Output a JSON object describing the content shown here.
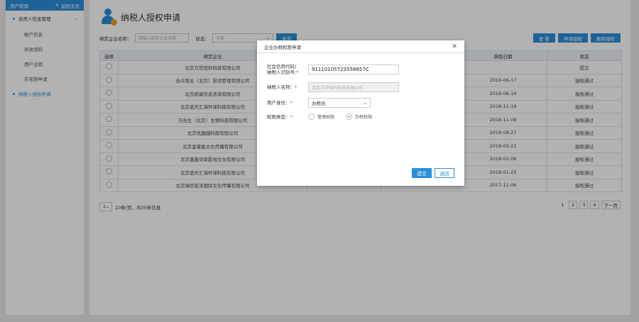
{
  "sidebar": {
    "header": "用户管理",
    "back_label": "返回主页",
    "groups": [
      {
        "label": "自然人信息管理",
        "items": [
          "帐户信息",
          "修改密码",
          "用户注销",
          "实名制申请"
        ]
      },
      {
        "label": "纳税人授权申请"
      }
    ]
  },
  "page": {
    "title": "纳税人授权申请",
    "filter_company_label": "绑定企业名称：",
    "filter_company_placeholder": "请输入绑定企业名称",
    "filter_status_label": "状态：",
    "filter_status_value": "全部",
    "query_button": "查询",
    "view_button": "查 看",
    "apply_button": "申请授权",
    "revoke_button": "解除授权"
  },
  "table": {
    "headers": [
      "选择",
      "绑定企业",
      "",
      "",
      "获取日期",
      "状态"
    ],
    "rows": [
      {
        "company": "北京方欣恒利科技有限公司",
        "date": "",
        "status": "提交"
      },
      {
        "company": "合众智业（北京）投资管理有限公司",
        "date": "2019-06-17",
        "status": "授权通过"
      },
      {
        "company": "北京拓睿信息咨询有限公司",
        "date": "2019-06-14",
        "status": "授权通过"
      },
      {
        "company": "北京蓝天汇海环保科技有限公司",
        "date": "2018-11-19",
        "status": "授权通过"
      },
      {
        "company": "万合生（北京）生物科技有限公司",
        "date": "2018-11-09",
        "status": "授权通过"
      },
      {
        "company": "北京优趣越科技有限公司",
        "date": "2018-08-27",
        "status": "授权通过"
      },
      {
        "company": "北京金睿盈文化传播有限公司",
        "date": "2018-03-21",
        "status": "授权通过"
      },
      {
        "company": "北京鑫鑫尚荣影视文化有限公司",
        "date": "2018-02-06",
        "status": "授权通过"
      },
      {
        "company": "北京蓝天汇海环保科技有限公司",
        "date": "2018-01-25",
        "status": "授权通过"
      },
      {
        "company": "北京瑞信蓝泽国际文化传播有限公司",
        "date": "2017-11-06",
        "status": "授权通过"
      }
    ]
  },
  "pager": {
    "page_size": "1",
    "summary": "10条/页，共35条信息",
    "pages": [
      "1",
      "2",
      "3",
      "4"
    ],
    "next": "下一页"
  },
  "modal": {
    "title": "企业办税权限申请",
    "code_label_1": "社会信用代码/",
    "code_label_2": "纳税人识别号:",
    "code_value": "91110105723558657C",
    "name_label": "纳税人名称：",
    "name_value": "北京方欣恒利科技有限公司",
    "role_label": "用户身份：",
    "role_value": "办税员",
    "perm_label": "权限类型：",
    "perm_options": [
      "管理权限",
      "办税权限"
    ],
    "perm_selected_index": 1,
    "submit": "提交",
    "cancel": "返回"
  },
  "colors": {
    "accent": "#2b8fd8",
    "required": "#e33333"
  }
}
